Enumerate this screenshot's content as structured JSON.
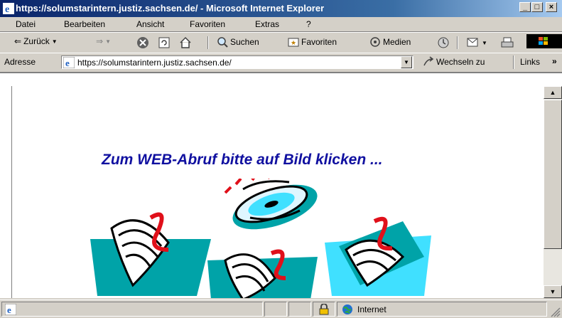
{
  "window": {
    "title": "https://solumstarintern.justiz.sachsen.de/ - Microsoft Internet Explorer",
    "minimize": "_",
    "maximize": "□",
    "close": "×"
  },
  "menu": {
    "items": [
      "Datei",
      "Bearbeiten",
      "Ansicht",
      "Favoriten",
      "Extras",
      "?"
    ]
  },
  "toolbar": {
    "back_label": "Zurück",
    "search_label": "Suchen",
    "favorites_label": "Favoriten",
    "media_label": "Medien",
    "more": "»"
  },
  "address": {
    "label": "Adresse",
    "url": "https://solumstarintern.justiz.sachsen.de/",
    "go_label": "Wechseln zu",
    "links_label": "Links",
    "more": "»"
  },
  "page": {
    "headline": "Zum WEB-Abruf bitte auf Bild klicken ..."
  },
  "statusbar": {
    "zone": "Internet"
  },
  "colors": {
    "headline": "#1010a0",
    "teal": "#00a3a8",
    "cyan": "#40e0ff",
    "red": "#e0101a"
  }
}
